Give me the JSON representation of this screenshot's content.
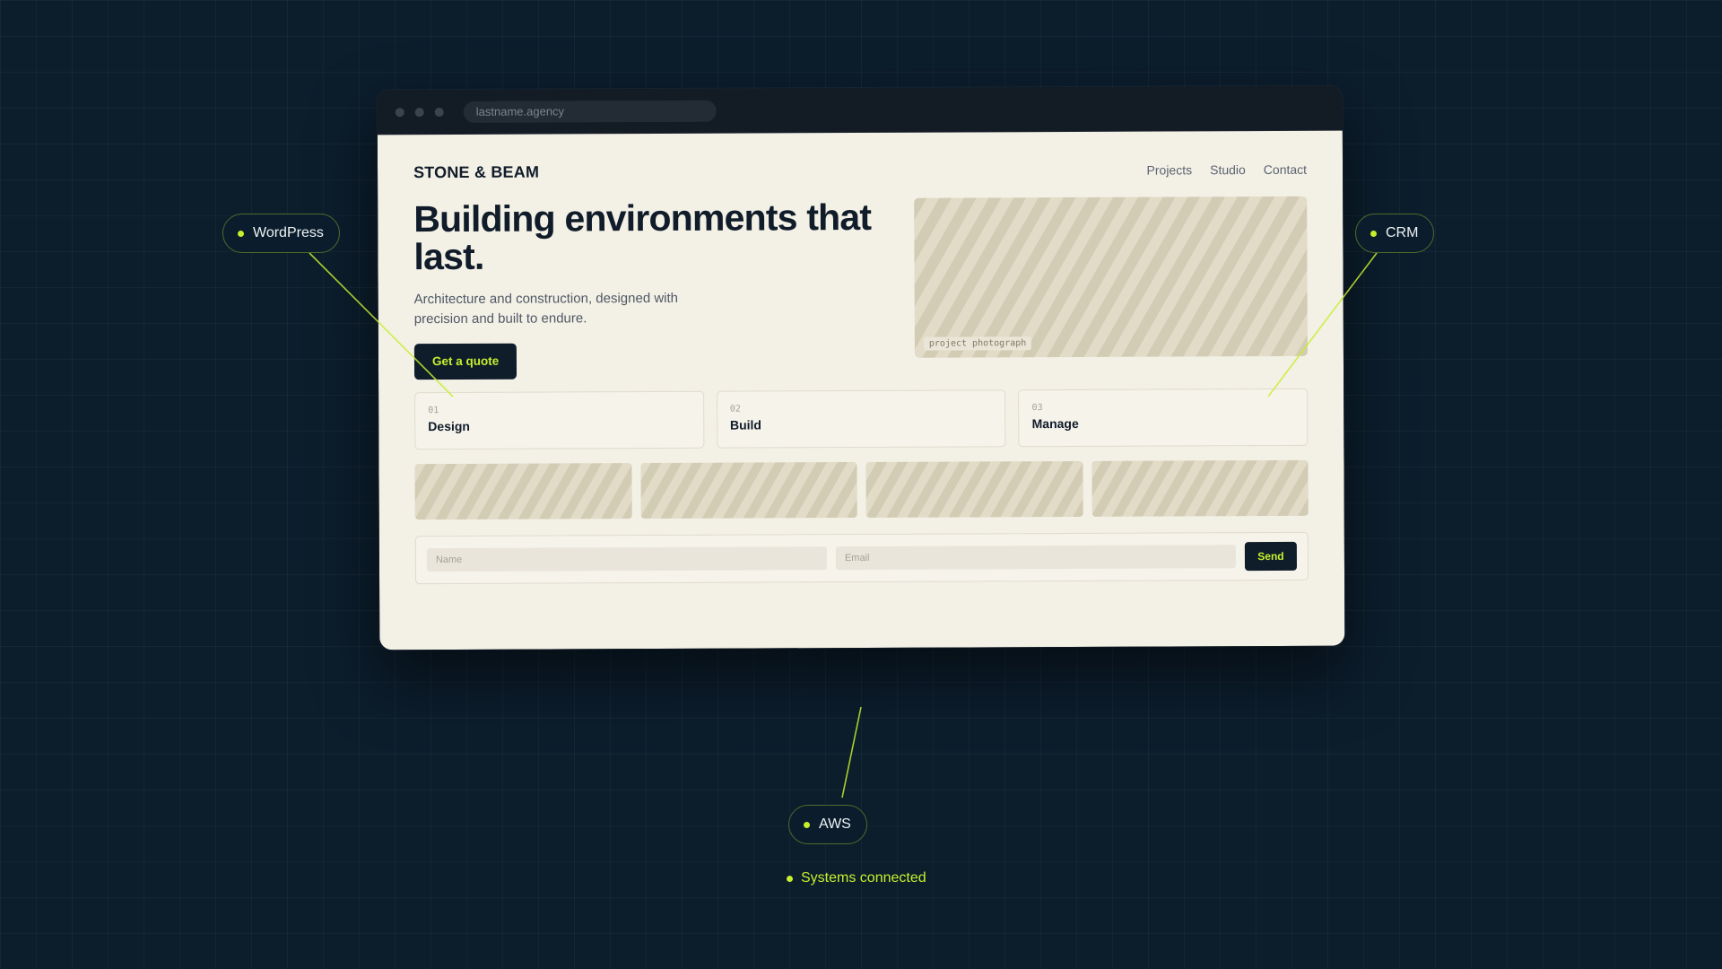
{
  "browser": {
    "url": "lastname.agency"
  },
  "site": {
    "logo": "STONE & BEAM",
    "nav": [
      "Projects",
      "Studio",
      "Contact"
    ],
    "hero": {
      "headline": "Building environments that last.",
      "subtext": "Architecture and construction, designed with precision and built to endure.",
      "cta_label": "Get a quote",
      "photo_label": "project photograph"
    },
    "services": [
      {
        "num": "01",
        "name": "Design"
      },
      {
        "num": "02",
        "name": "Build"
      },
      {
        "num": "03",
        "name": "Manage"
      }
    ],
    "form": {
      "name_placeholder": "Name",
      "email_placeholder": "Email",
      "send_label": "Send"
    }
  },
  "integrations": {
    "wordpress": "WordPress",
    "crm": "CRM",
    "aws": "AWS",
    "status": "Systems connected"
  },
  "colors": {
    "background": "#0c1d2c",
    "accent": "#c6ef2e",
    "page": "#f3f0e6",
    "ink": "#101c29"
  }
}
